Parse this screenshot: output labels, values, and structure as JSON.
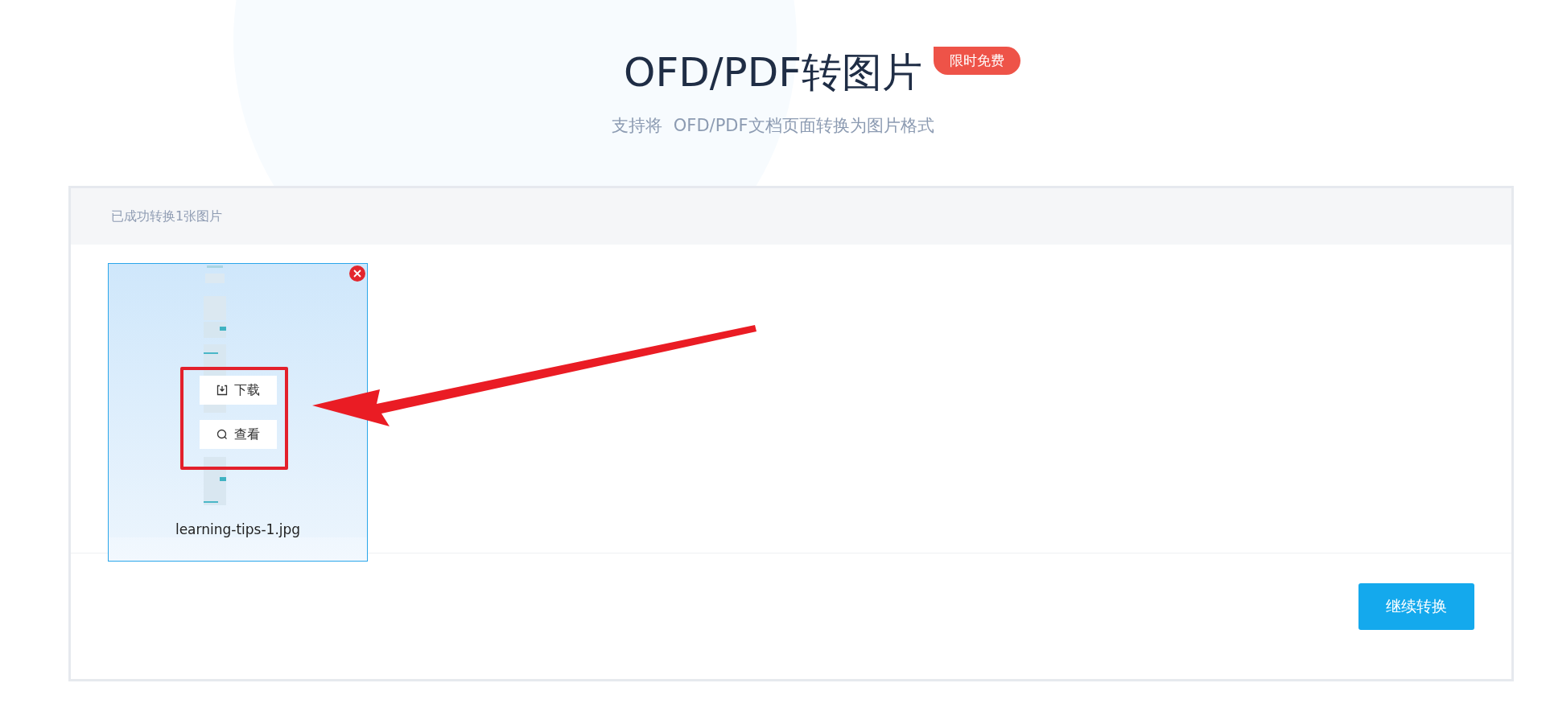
{
  "header": {
    "title": "OFD/PDF转图片",
    "badge": "限时免费",
    "subtitle": "支持将  OFD/PDF文档页面转换为图片格式"
  },
  "result": {
    "status": "已成功转换1张图片",
    "files": [
      {
        "name": "learning-tips-1.jpg",
        "actions": [
          {
            "kind": "download",
            "label": "下载"
          },
          {
            "kind": "view",
            "label": "查看"
          }
        ]
      }
    ]
  },
  "continue_button": "继续转换"
}
